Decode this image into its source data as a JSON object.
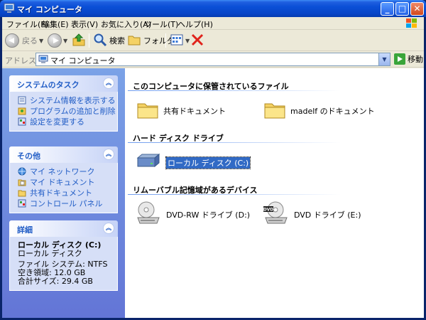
{
  "window": {
    "title": "マイ コンピュータ",
    "minimize_label": "_",
    "maximize_label": "□",
    "close_label": "✕"
  },
  "menu": {
    "items": [
      "ファイル(F)",
      "編集(E)",
      "表示(V)",
      "お気に入り(A)",
      "ツール(T)",
      "ヘルプ(H)"
    ]
  },
  "toolbar": {
    "back_label": "戻る",
    "search_label": "検索",
    "folders_label": "フォルダ"
  },
  "address": {
    "label": "アドレス(D)",
    "value": "マイ コンピュータ",
    "go_label": "移動"
  },
  "taskpane": {
    "system_tasks": {
      "title": "システムのタスク",
      "links": [
        "システム情報を表示する",
        "プログラムの追加と削除",
        "設定を変更する"
      ]
    },
    "other_places": {
      "title": "その他",
      "links": [
        "マイ ネットワーク",
        "マイ ドキュメント",
        "共有ドキュメント",
        "コントロール パネル"
      ]
    },
    "details": {
      "title": "詳細",
      "name": "ローカル ディスク (C:)",
      "type": "ローカル ディスク",
      "filesystem": "ファイル システム: NTFS",
      "free_space": "空き領域: 12.0 GB",
      "total_size": "合計サイズ: 29.4 GB"
    }
  },
  "content": {
    "groups": {
      "stored_files": "このコンピュータに保管されているファイル",
      "hard_drives": "ハード ディスク ドライブ",
      "removable": "リムーバブル記憶域があるデバイス"
    },
    "items": {
      "shared_docs": "共有ドキュメント",
      "user_docs": "madelf のドキュメント",
      "local_disk": "ローカル ディスク (C:)",
      "dvd_rw": "DVD-RW ドライブ (D:)",
      "dvd": "DVD ドライブ (E:)"
    }
  },
  "colors": {
    "title_bar": "#0a4fd6",
    "task_pane_top": "#7ba2e7",
    "task_pane_bottom": "#6375d6",
    "link_blue": "#215dc6",
    "selection": "#316ac5"
  }
}
